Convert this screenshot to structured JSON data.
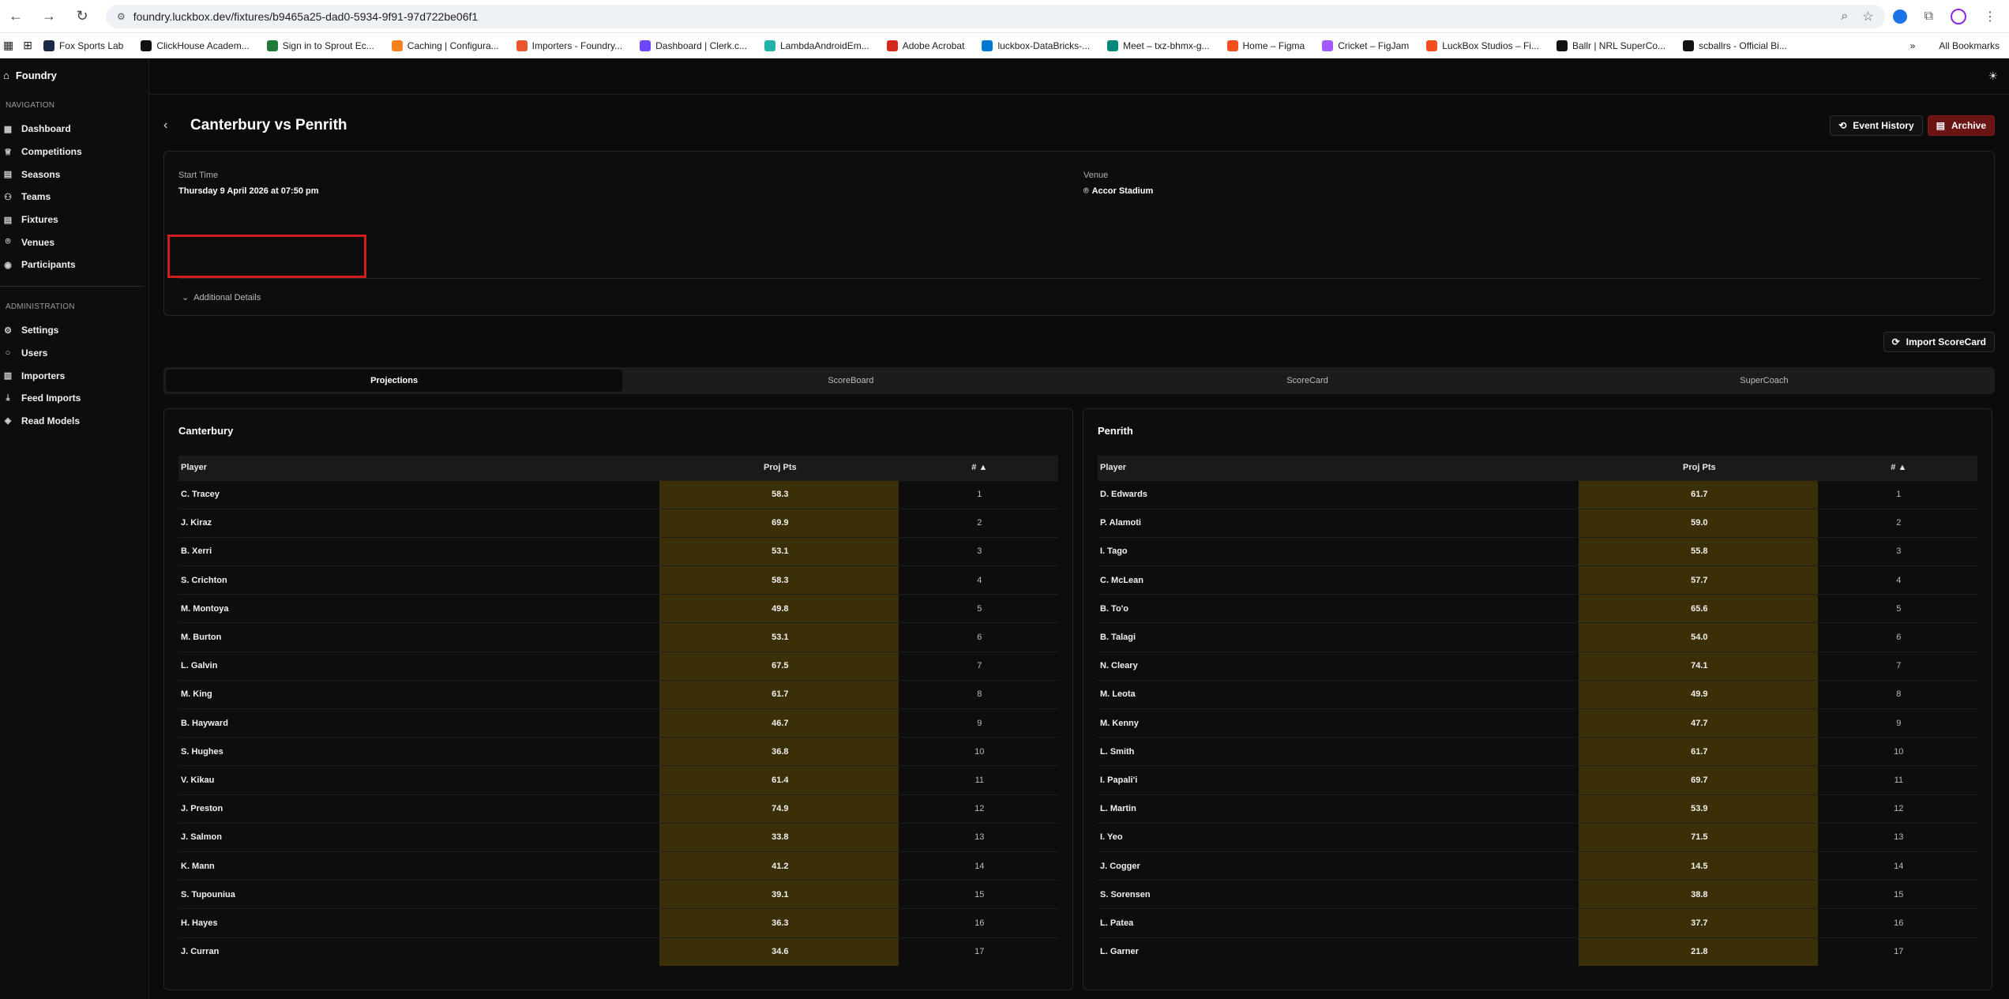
{
  "browser": {
    "url": "foundry.luckbox.dev/fixtures/b9465a25-dad0-5934-9f91-97d722be06f1",
    "bookmarks": [
      {
        "label": "Fox Sports Lab",
        "color": "#1b2a4a"
      },
      {
        "label": "ClickHouse Academ...",
        "color": "#111111"
      },
      {
        "label": "Sign in to Sprout Ec...",
        "color": "#1f7a3a"
      },
      {
        "label": "Caching | Configura...",
        "color": "#f48120"
      },
      {
        "label": "Importers - Foundry...",
        "color": "#e8552f"
      },
      {
        "label": "Dashboard | Clerk.c...",
        "color": "#6c47ff"
      },
      {
        "label": "LambdaAndroidEm...",
        "color": "#20b2aa"
      },
      {
        "label": "Adobe Acrobat",
        "color": "#d4271d"
      },
      {
        "label": "luckbox-DataBricks-...",
        "color": "#0078d4"
      },
      {
        "label": "Meet – txz-bhmx-g...",
        "color": "#00897b"
      },
      {
        "label": "Home – Figma",
        "color": "#f24e1e"
      },
      {
        "label": "Cricket – FigJam",
        "color": "#a259ff"
      },
      {
        "label": "LuckBox Studios – Fi...",
        "color": "#f24e1e"
      },
      {
        "label": "Ballr | NRL SuperCo...",
        "color": "#111111"
      },
      {
        "label": "scballrs - Official Bi...",
        "color": "#111111"
      }
    ],
    "all_bookmarks": "All Bookmarks"
  },
  "sidebar": {
    "brand": "Foundry",
    "navigation_label": "NAVIGATION",
    "navigation": [
      {
        "label": "Dashboard",
        "icon": "grid-icon"
      },
      {
        "label": "Competitions",
        "icon": "trophy-icon"
      },
      {
        "label": "Seasons",
        "icon": "calendar-icon"
      },
      {
        "label": "Teams",
        "icon": "users-icon"
      },
      {
        "label": "Fixtures",
        "icon": "calendar-icon"
      },
      {
        "label": "Venues",
        "icon": "map-pin-icon"
      },
      {
        "label": "Participants",
        "icon": "user-circle-icon"
      }
    ],
    "administration_label": "ADMINISTRATION",
    "administration": [
      {
        "label": "Settings",
        "icon": "gear-icon"
      },
      {
        "label": "Users",
        "icon": "user-icon"
      },
      {
        "label": "Importers",
        "icon": "file-icon"
      },
      {
        "label": "Feed Imports",
        "icon": "download-icon"
      },
      {
        "label": "Read Models",
        "icon": "layers-icon"
      }
    ]
  },
  "header": {
    "title": "Canterbury vs Penrith",
    "event_history": "Event History",
    "archive": "Archive"
  },
  "fixture_info": {
    "start_time_label": "Start Time",
    "start_time_value": "Thursday 9 April 2026 at 07:50 pm",
    "venue_label": "Venue",
    "venue_value": "Accor Stadium",
    "additional_details": "Additional Details"
  },
  "import_scorecard": "Import ScoreCard",
  "tabs": [
    "Projections",
    "ScoreBoard",
    "ScoreCard",
    "SuperCoach"
  ],
  "active_tab": "Projections",
  "table_headers": {
    "player": "Player",
    "proj": "Proj Pts",
    "rank": "# ▲"
  },
  "teams": [
    {
      "name": "Canterbury",
      "players": [
        [
          "C. Tracey",
          "58.3",
          "1"
        ],
        [
          "J. Kiraz",
          "69.9",
          "2"
        ],
        [
          "B. Xerri",
          "53.1",
          "3"
        ],
        [
          "S. Crichton",
          "58.3",
          "4"
        ],
        [
          "M. Montoya",
          "49.8",
          "5"
        ],
        [
          "M. Burton",
          "53.1",
          "6"
        ],
        [
          "L. Galvin",
          "67.5",
          "7"
        ],
        [
          "M. King",
          "61.7",
          "8"
        ],
        [
          "B. Hayward",
          "46.7",
          "9"
        ],
        [
          "S. Hughes",
          "36.8",
          "10"
        ],
        [
          "V. Kikau",
          "61.4",
          "11"
        ],
        [
          "J. Preston",
          "74.9",
          "12"
        ],
        [
          "J. Salmon",
          "33.8",
          "13"
        ],
        [
          "K. Mann",
          "41.2",
          "14"
        ],
        [
          "S. Tupouniua",
          "39.1",
          "15"
        ],
        [
          "H. Hayes",
          "36.3",
          "16"
        ],
        [
          "J. Curran",
          "34.6",
          "17"
        ]
      ]
    },
    {
      "name": "Penrith",
      "players": [
        [
          "D. Edwards",
          "61.7",
          "1"
        ],
        [
          "P. Alamoti",
          "59.0",
          "2"
        ],
        [
          "I. Tago",
          "55.8",
          "3"
        ],
        [
          "C. McLean",
          "57.7",
          "4"
        ],
        [
          "B. To'o",
          "65.6",
          "5"
        ],
        [
          "B. Talagi",
          "54.0",
          "6"
        ],
        [
          "N. Cleary",
          "74.1",
          "7"
        ],
        [
          "M. Leota",
          "49.9",
          "8"
        ],
        [
          "M. Kenny",
          "47.7",
          "9"
        ],
        [
          "L. Smith",
          "61.7",
          "10"
        ],
        [
          "I. Papali'i",
          "69.7",
          "11"
        ],
        [
          "L. Martin",
          "53.9",
          "12"
        ],
        [
          "I. Yeo",
          "71.5",
          "13"
        ],
        [
          "J. Cogger",
          "14.5",
          "14"
        ],
        [
          "S. Sorensen",
          "38.8",
          "15"
        ],
        [
          "L. Patea",
          "37.7",
          "16"
        ],
        [
          "L. Garner",
          "21.8",
          "17"
        ]
      ]
    }
  ]
}
